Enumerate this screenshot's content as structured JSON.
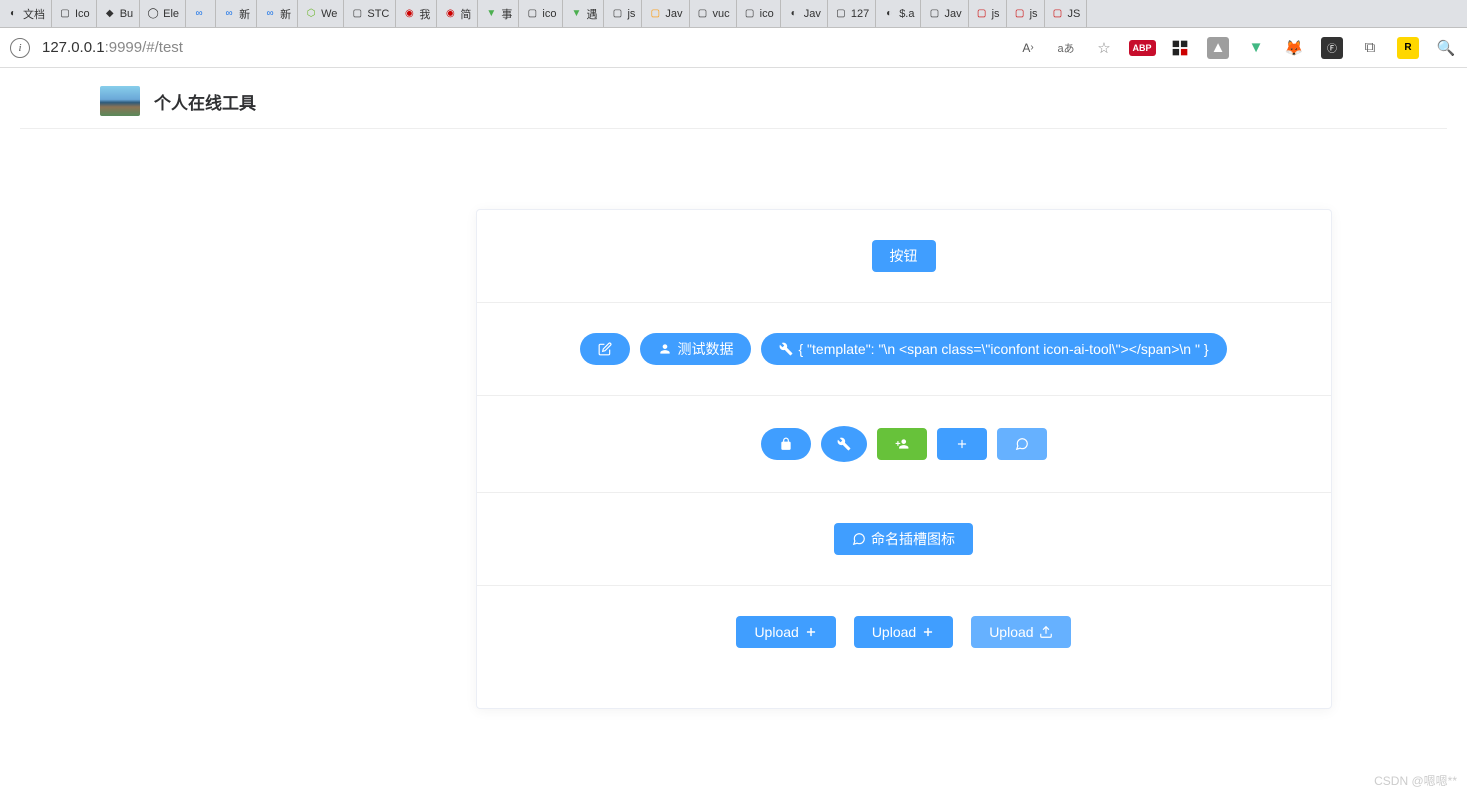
{
  "browser": {
    "tabs": [
      "文档",
      "Ico",
      "Bu",
      "Ele",
      "",
      "新",
      "新",
      "We",
      "STC",
      "我",
      "简",
      "事",
      "ico",
      "遇",
      "js",
      "Jav",
      "vuc",
      "ico",
      "Jav",
      "127",
      "$.a",
      "Jav",
      "js",
      "js",
      "JS"
    ],
    "url_host": "127.0.0.1",
    "url_port_path": ":9999/#/test"
  },
  "header": {
    "title": "个人在线工具"
  },
  "section1": {
    "button_label": "按钮"
  },
  "section2": {
    "edit_icon_button": "edit",
    "test_data_label": "测试数据",
    "template_label": "{ \"template\": \"\\n <span class=\\\"iconfont icon-ai-tool\\\"></span>\\n \" }"
  },
  "section3": {
    "icons": [
      "lock-icon",
      "tools-icon",
      "user-add-icon",
      "plus-icon",
      "chat-icon"
    ]
  },
  "section4": {
    "named_slot_label": "命名插槽图标"
  },
  "section5": {
    "upload1_label": "Upload",
    "upload2_label": "Upload",
    "upload3_label": "Upload"
  },
  "watermark": "CSDN @嗯嗯**"
}
